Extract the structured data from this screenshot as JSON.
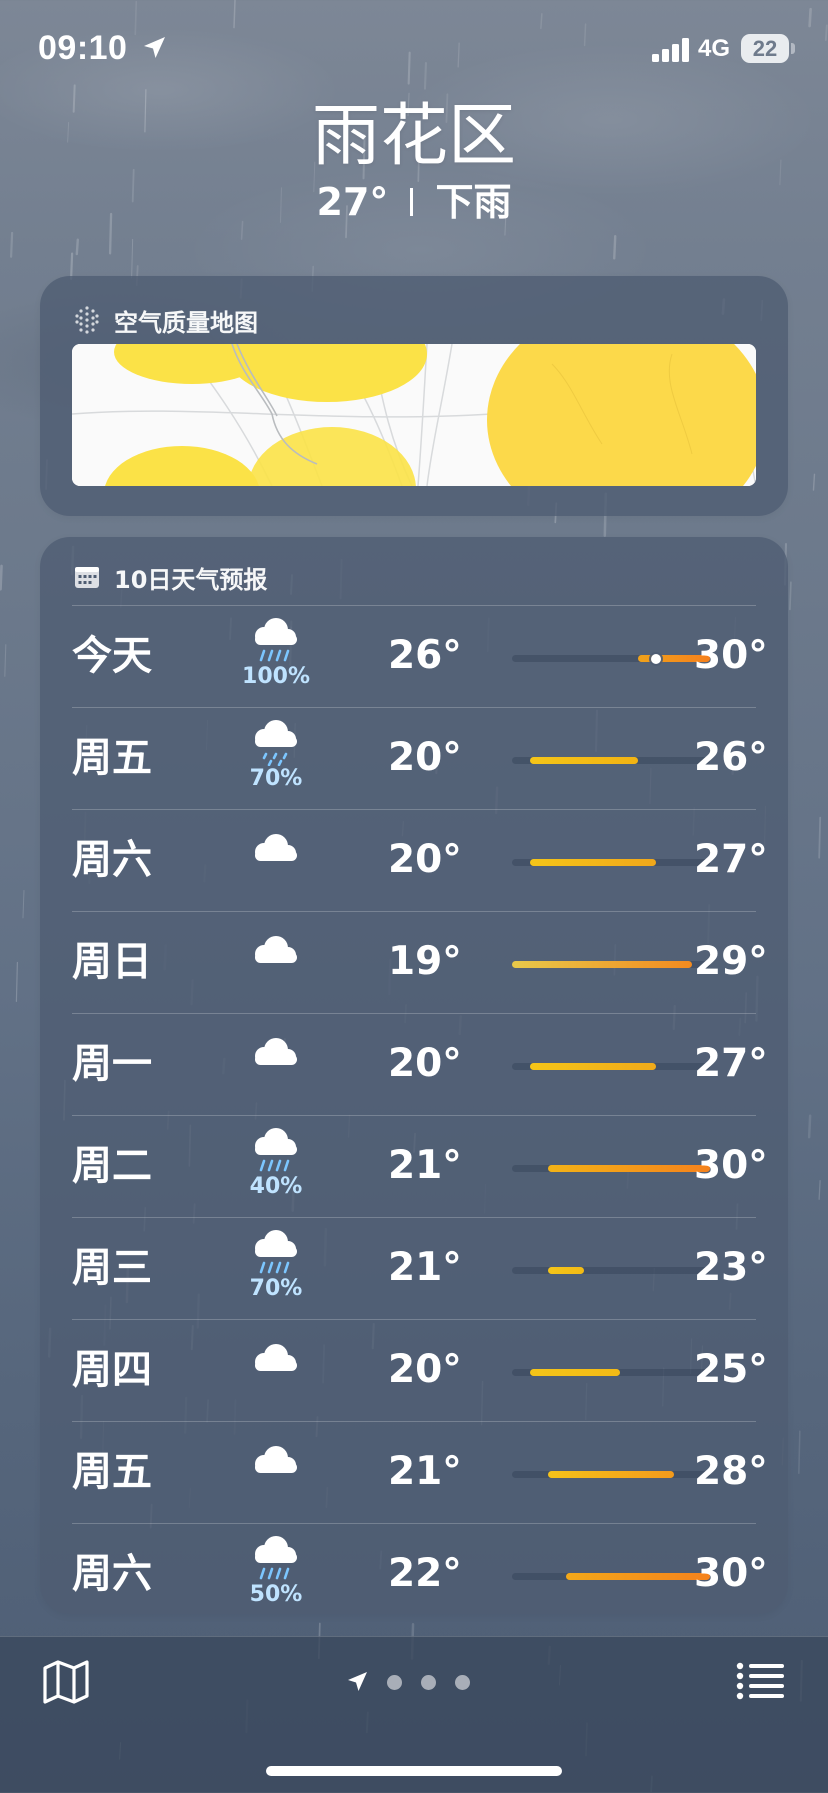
{
  "status_bar": {
    "time": "09:10",
    "network": "4G",
    "battery": "22",
    "icons": [
      "location-arrow-icon",
      "signal-bars-icon"
    ]
  },
  "header": {
    "location": "雨花区",
    "temperature": "27°",
    "condition": "下雨"
  },
  "air_quality_card": {
    "title": "空气质量地图",
    "icon": "air-quality-dots-icon"
  },
  "forecast_card": {
    "title": "10日天气预报",
    "icon": "calendar-icon",
    "scale_min": 19,
    "scale_max": 30,
    "days": [
      {
        "day": "今天",
        "icon": "rain-cloud-icon",
        "precip": "100%",
        "low": "26°",
        "high": "30°",
        "low_val": 26,
        "high_val": 30,
        "current_val": 27,
        "colors": [
          "#f0a21b",
          "#f6801c"
        ]
      },
      {
        "day": "周五",
        "icon": "drizzle-cloud-icon",
        "precip": "70%",
        "low": "20°",
        "high": "26°",
        "low_val": 20,
        "high_val": 26,
        "colors": [
          "#f5c518",
          "#f2b313"
        ]
      },
      {
        "day": "周六",
        "icon": "cloud-icon",
        "precip": "",
        "low": "20°",
        "high": "27°",
        "low_val": 20,
        "high_val": 27,
        "colors": [
          "#f5c518",
          "#f0a71b"
        ]
      },
      {
        "day": "周日",
        "icon": "cloud-icon",
        "precip": "",
        "low": "19°",
        "high": "29°",
        "low_val": 19,
        "high_val": 29,
        "colors": [
          "#e8c94a",
          "#f28a1f"
        ]
      },
      {
        "day": "周一",
        "icon": "cloud-icon",
        "precip": "",
        "low": "20°",
        "high": "27°",
        "low_val": 20,
        "high_val": 27,
        "colors": [
          "#f5c518",
          "#f0aa1a"
        ]
      },
      {
        "day": "周二",
        "icon": "rain-cloud-icon",
        "precip": "40%",
        "low": "21°",
        "high": "30°",
        "low_val": 21,
        "high_val": 30,
        "colors": [
          "#f3b317",
          "#f5821c"
        ]
      },
      {
        "day": "周三",
        "icon": "rain-cloud-icon",
        "precip": "70%",
        "low": "21°",
        "high": "23°",
        "low_val": 21,
        "high_val": 23,
        "colors": [
          "#f5c518",
          "#f3bb15"
        ]
      },
      {
        "day": "周四",
        "icon": "cloud-icon",
        "precip": "",
        "low": "20°",
        "high": "25°",
        "low_val": 20,
        "high_val": 25,
        "colors": [
          "#f5c518",
          "#f3ba16"
        ]
      },
      {
        "day": "周五",
        "icon": "cloud-icon",
        "precip": "",
        "low": "21°",
        "high": "28°",
        "low_val": 21,
        "high_val": 28,
        "colors": [
          "#f5c21a",
          "#f39a1b"
        ]
      },
      {
        "day": "周六",
        "icon": "rain-cloud-icon",
        "precip": "50%",
        "low": "22°",
        "high": "30°",
        "low_val": 22,
        "high_val": 30,
        "colors": [
          "#f3a81a",
          "#f5821c"
        ]
      }
    ]
  },
  "toolbar": {
    "left_icon": "map-icon",
    "right_icon": "list-icon",
    "page_count": 3,
    "current_page": "location"
  }
}
